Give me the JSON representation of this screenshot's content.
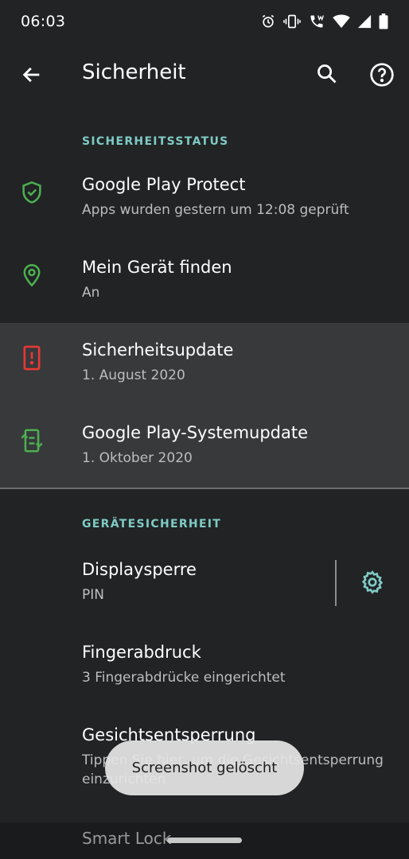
{
  "status": {
    "time": "06:03",
    "icons": [
      "alarm-icon",
      "vibrate-icon",
      "wifi-calling-icon",
      "wifi-icon",
      "signal-icon",
      "battery-icon"
    ]
  },
  "app_bar": {
    "title": "Sicherheit",
    "back_icon": "arrow-back-icon",
    "search_icon": "search-icon",
    "help_icon": "help-icon"
  },
  "sections": {
    "status_header": "SICHERHEITSSTATUS",
    "device_header": "GERÄTESICHERHEIT"
  },
  "status_items": [
    {
      "title": "Google Play Protect",
      "subtitle": "Apps wurden gestern um 12:08 geprüft",
      "icon": "shield-check-icon",
      "color": "#4caf50"
    },
    {
      "title": "Mein Gerät finden",
      "subtitle": "An",
      "icon": "location-pin-icon",
      "color": "#4caf50"
    },
    {
      "title": "Sicherheitsupdate",
      "subtitle": "1. August 2020",
      "icon": "phone-alert-icon",
      "color": "#e53935"
    },
    {
      "title": "Google Play-Systemupdate",
      "subtitle": "1. Oktober 2020",
      "icon": "phone-sync-icon",
      "color": "#4caf50"
    }
  ],
  "device_items": [
    {
      "title": "Displaysperre",
      "subtitle": "PIN",
      "action_icon": "gear-icon"
    },
    {
      "title": "Fingerabdruck",
      "subtitle": "3 Fingerabdrücke eingerichtet"
    },
    {
      "title": "Gesichtsentsperrung",
      "subtitle": "Tippen Sie hier, um die Gesichtsentsperrung einzurichten"
    },
    {
      "title": "Smart Lock"
    }
  ],
  "toast": {
    "text": "Screenshot gelöscht"
  },
  "colors": {
    "background": "#212325",
    "accent": "#7fcbc4",
    "highlight": "#37393b",
    "ok": "#4caf50",
    "alert": "#e53935"
  }
}
